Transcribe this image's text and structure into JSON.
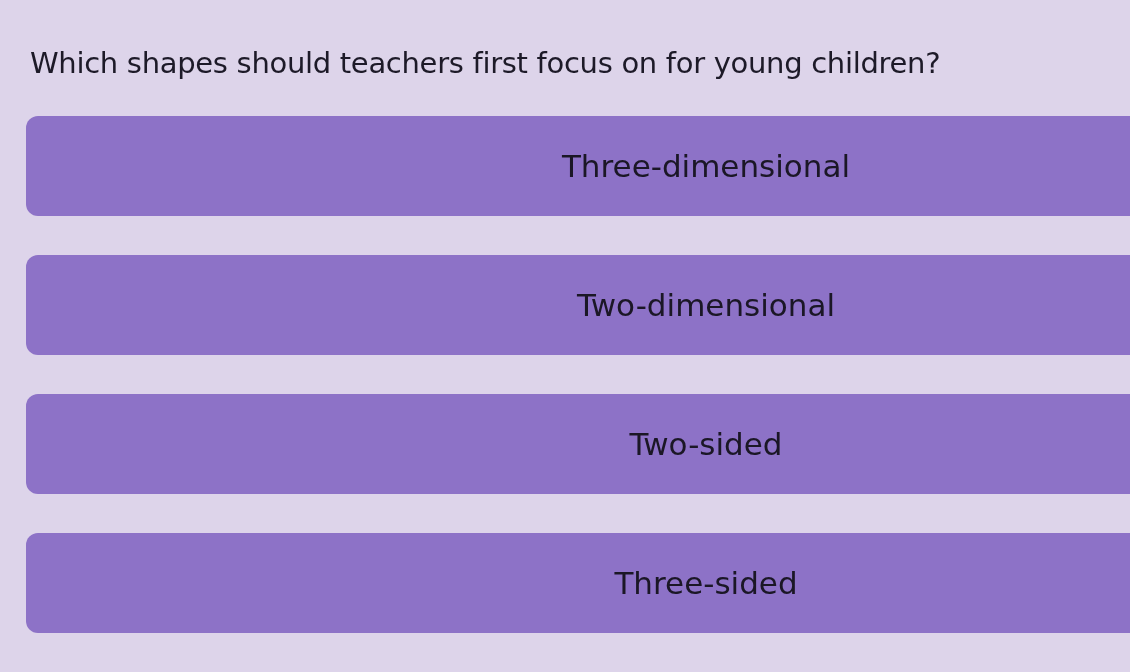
{
  "question": "Which shapes should teachers first focus on for young children?",
  "options": [
    {
      "label": "Three-dimensional"
    },
    {
      "label": "Two-dimensional"
    },
    {
      "label": "Two-sided"
    },
    {
      "label": "Three-sided"
    }
  ]
}
